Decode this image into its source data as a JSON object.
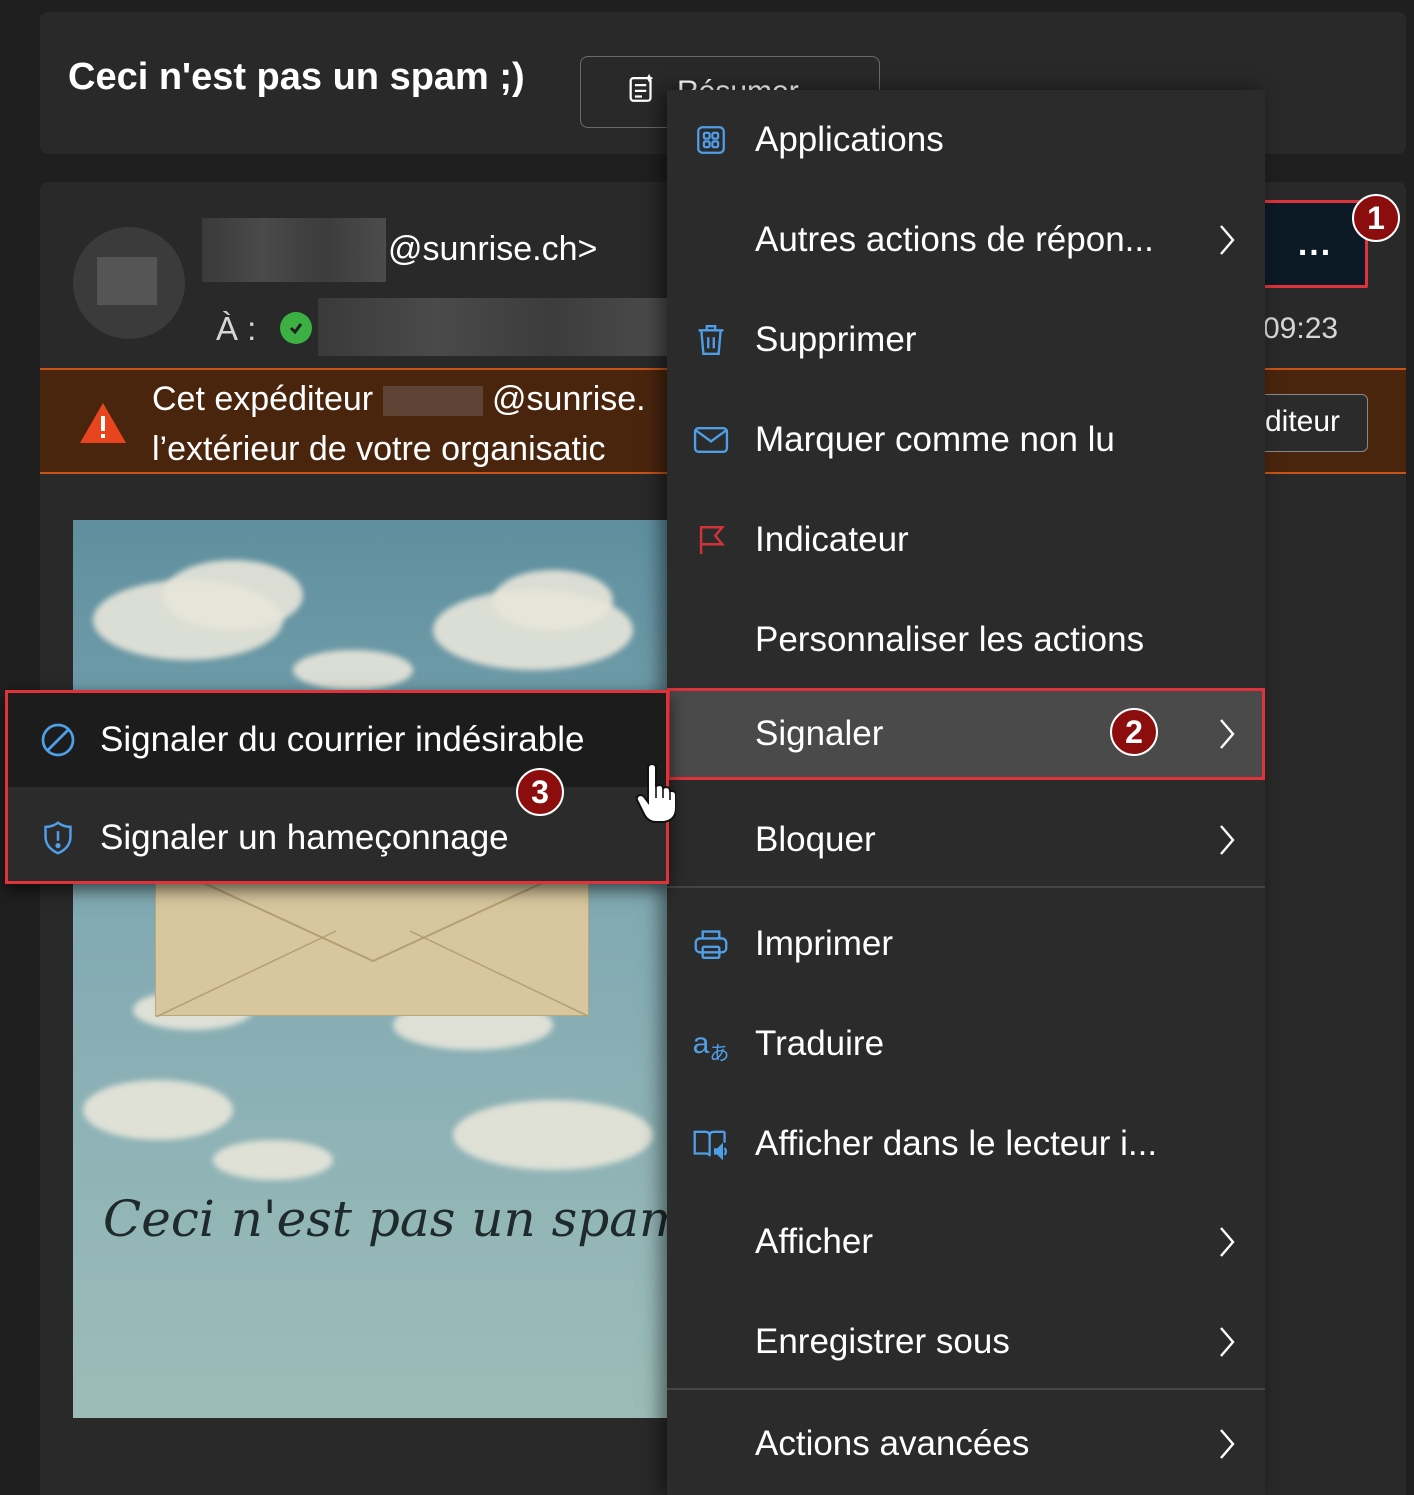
{
  "subject": {
    "title": "Ceci n'est pas un spam ;)",
    "summary_label": "Résumer"
  },
  "message": {
    "from_domain": "@sunrise.ch>",
    "to_label": "À :",
    "time": "09:23",
    "more_button_label": "...",
    "warning": {
      "line1_prefix": "Cet expéditeur",
      "line1_suffix": "@sunrise.",
      "line2": "l’extérieur de votre organisatic",
      "sender_button_label": "diteur"
    },
    "image_caption": "Ceci n'est pas un spam"
  },
  "context_menu": {
    "items": [
      {
        "label": "Applications",
        "icon": "apps-icon",
        "has_submenu": false
      },
      {
        "label": "Autres actions de répon...",
        "icon": "",
        "has_submenu": true
      },
      {
        "label": "Supprimer",
        "icon": "trash-icon",
        "has_submenu": false
      },
      {
        "label": "Marquer comme non lu",
        "icon": "mail-icon",
        "has_submenu": false
      },
      {
        "label": "Indicateur",
        "icon": "flag-icon",
        "has_submenu": false
      },
      {
        "label": "Personnaliser les actions",
        "icon": "",
        "has_submenu": false
      },
      {
        "label": "Signaler",
        "icon": "",
        "has_submenu": true
      },
      {
        "label": "Bloquer",
        "icon": "",
        "has_submenu": true
      },
      {
        "label": "Imprimer",
        "icon": "printer-icon",
        "has_submenu": false
      },
      {
        "label": "Traduire",
        "icon": "translate-icon",
        "has_submenu": false
      },
      {
        "label": "Afficher dans le lecteur i...",
        "icon": "immersive-reader-icon",
        "has_submenu": false
      },
      {
        "label": "Afficher",
        "icon": "",
        "has_submenu": true
      },
      {
        "label": "Enregistrer sous",
        "icon": "",
        "has_submenu": true
      },
      {
        "label": "Actions avancées",
        "icon": "",
        "has_submenu": true
      }
    ]
  },
  "report_submenu": {
    "items": [
      {
        "label": "Signaler du courrier indésirable",
        "icon": "block-icon"
      },
      {
        "label": "Signaler un hameçonnage",
        "icon": "shield-icon"
      }
    ]
  },
  "steps": {
    "step1": "1",
    "step2": "2",
    "step3": "3"
  },
  "colors": {
    "highlight_red": "#e0323a",
    "step_marker": "#8b0d0d",
    "warning_bg": "#4a250e",
    "accent_blue": "#4f9fe8",
    "flag_red": "#d13438"
  }
}
